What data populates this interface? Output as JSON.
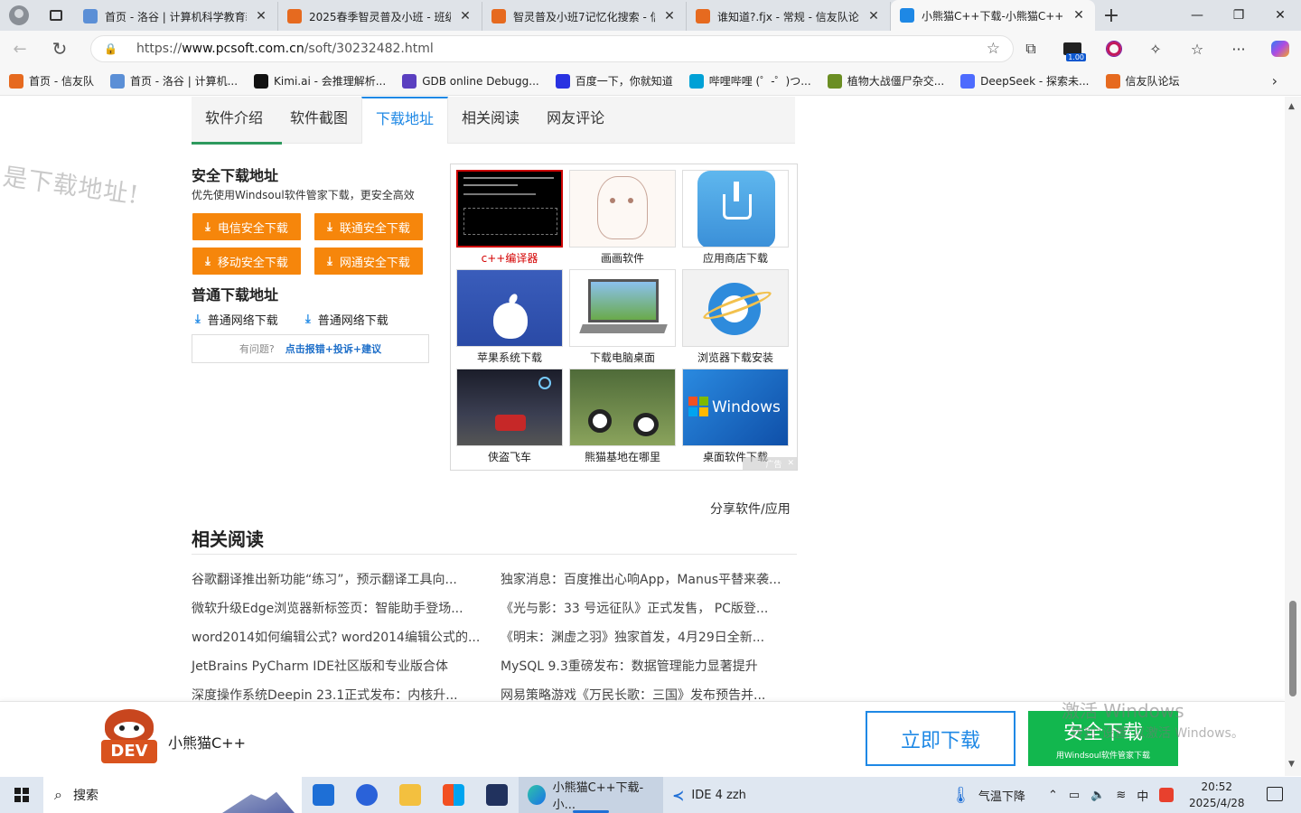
{
  "browser": {
    "tabs": [
      {
        "title": "首页 - 洛谷 | 计算机科学教育新",
        "icon_color": "#5b8fd6",
        "icon": "luogu-icon"
      },
      {
        "title": "2025春季智灵普及小班 - 班级详",
        "icon_color": "#e66a1f",
        "icon": "xinyou-icon"
      },
      {
        "title": "智灵普及小班7记忆化搜索 - 信",
        "icon_color": "#e66a1f",
        "icon": "xinyou-icon"
      },
      {
        "title": "谁知道?.fjx - 常规 - 信友队论坛",
        "icon_color": "#e66a1f",
        "icon": "xinyou-icon"
      },
      {
        "title": "小熊猫C++下载-小熊猫C++官方",
        "icon_color": "#1e88e5",
        "icon": "pcsoft-icon",
        "active": true
      }
    ],
    "url_prefix": "https://",
    "url_host": "www.pcsoft.com.cn",
    "url_path": "/soft/30232482.html",
    "ext_badge": "1.00",
    "bookmarks": [
      {
        "label": "首页 - 信友队",
        "color": "#e66a1f"
      },
      {
        "label": "首页 - 洛谷 | 计算机...",
        "color": "#5b8fd6"
      },
      {
        "label": "Kimi.ai - 会推理解析...",
        "color": "#111111"
      },
      {
        "label": "GDB online Debugg...",
        "color": "#5a3fc0"
      },
      {
        "label": "百度一下，你就知道",
        "color": "#2932e1"
      },
      {
        "label": "哔哩哔哩 (゜-゜)つ...",
        "color": "#00a1d6"
      },
      {
        "label": "植物大战僵尸杂交...",
        "color": "#6b8e23"
      },
      {
        "label": "DeepSeek - 探索未...",
        "color": "#4d6bfe"
      },
      {
        "label": "信友队论坛",
        "color": "#e66a1f"
      }
    ]
  },
  "page": {
    "watermark_text": "是下载地址!",
    "nav_tabs": [
      "软件介绍",
      "软件截图",
      "下载地址",
      "相关阅读",
      "网友评论"
    ],
    "active_tab_index": 2,
    "safe_title": "安全下载地址",
    "safe_sub": "优先使用Windsoul软件管家下载，更安全高效",
    "safe_buttons": [
      "电信安全下载",
      "联通安全下载",
      "移动安全下载",
      "网通安全下载"
    ],
    "normal_title": "普通下载地址",
    "normal_links": [
      "普通网络下载",
      "普通网络下载"
    ],
    "report_q": "有问题?",
    "report_link": "点击报错+投诉+建议",
    "ads": [
      {
        "caption": "c++编译器",
        "red": true
      },
      {
        "caption": "画画软件"
      },
      {
        "caption": "应用商店下载"
      },
      {
        "caption": "苹果系统下载"
      },
      {
        "caption": "下载电脑桌面"
      },
      {
        "caption": "浏览器下载安装"
      },
      {
        "caption": "侠盗飞车"
      },
      {
        "caption": "熊猫基地在哪里"
      },
      {
        "caption": "桌面软件下载"
      }
    ],
    "ad_tag": "广告",
    "ad_windows_word": "Windows",
    "share": "分享软件/应用",
    "related_title": "相关阅读",
    "related": [
      [
        "谷歌翻译推出新功能“练习”，预示翻译工具向...",
        "独家消息：百度推出心响App，Manus平替来袭..."
      ],
      [
        "微软升级Edge浏览器新标签页：智能助手登场...",
        "《光与影：33 号远征队》正式发售， PC版登..."
      ],
      [
        "word2014如何编辑公式? word2014编辑公式的...",
        "《明末：渊虚之羽》独家首发，4月29日全新..."
      ],
      [
        "JetBrains PyCharm IDE社区版和专业版合体",
        "MySQL 9.3重磅发布：数据管理能力显著提升"
      ],
      [
        "深度操作系统Deepin 23.1正式发布：内核升...",
        "网易策略游戏《万民长歌：三国》发布预告并..."
      ]
    ],
    "sticky": {
      "app_name": "小熊猫C++",
      "logo_text": "DEV",
      "btn_now": "立即下载",
      "btn_safe": "安全下载",
      "btn_safe_sub": "用Windsoul软件管家下载"
    },
    "activate_1": "激活 Windows",
    "activate_2": "转到\"设置\"以激活 Windows。"
  },
  "taskbar": {
    "search": "搜索",
    "windows": [
      {
        "label": "小熊猫C++下载-小...",
        "active": true
      },
      {
        "label": "IDE 4 zzh"
      }
    ],
    "weather": "气温下降",
    "ime": "中",
    "time": "20:52",
    "date": "2025/4/28"
  }
}
